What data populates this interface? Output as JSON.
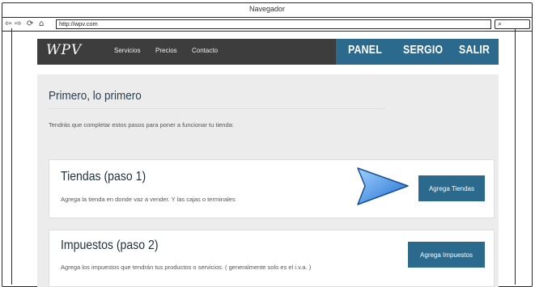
{
  "browser": {
    "title": "Navegador",
    "url": "http://wpv.com",
    "nav_icons": [
      "back-icon",
      "forward-icon",
      "reload-icon",
      "home-icon"
    ],
    "nav_glyphs": [
      "⇦",
      "⇨",
      "⟳",
      "⌂"
    ],
    "search_glyph": "⌕"
  },
  "app": {
    "logo": "WPV",
    "nav": [
      "Servicios",
      "Precios",
      "Contacto"
    ],
    "header_buttons": [
      "PANEL",
      "SERGIO",
      "SALIR"
    ]
  },
  "main": {
    "title": "Primero, lo primero",
    "intro": "Tendrás que completar estos pasos para poner a funcionar tu tienda:",
    "steps": [
      {
        "title": "Tiendas (paso 1)",
        "description": "Agrega la tienda en donde vaz a vender. Y las cajas o terminales",
        "button": "Agrega Tiendas"
      },
      {
        "title": "Impuestos (paso 2)",
        "description": "Agrega los impuestos que tendrán tus productos o servicios. ( generalmente solo es el i.v.a. )",
        "button": "Agrega Impuestos"
      }
    ]
  },
  "colors": {
    "header_bg": "#3d3d3d",
    "accent": "#2b6a8c",
    "page_bg": "#ececec",
    "arrow": "#3a8ee0"
  }
}
